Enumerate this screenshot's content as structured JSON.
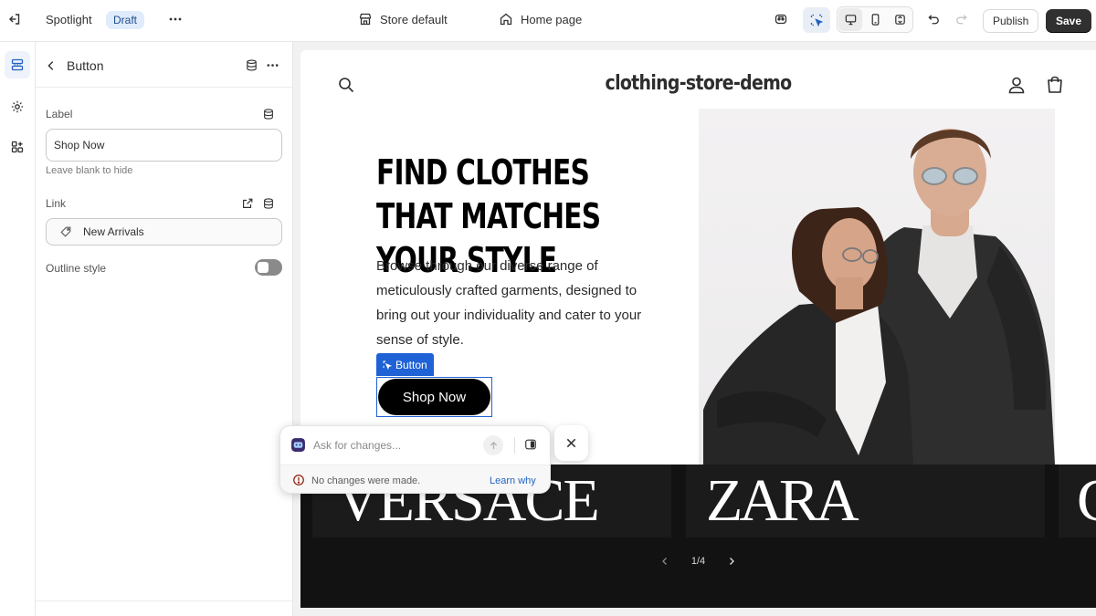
{
  "topbar": {
    "theme_name": "Spotlight",
    "status_badge": "Draft",
    "store_selector": "Store default",
    "page_selector": "Home page",
    "publish_label": "Publish",
    "save_label": "Save"
  },
  "panel": {
    "title": "Button",
    "label_field": {
      "label": "Label",
      "value": "Shop Now",
      "help": "Leave blank to hide"
    },
    "link_field": {
      "label": "Link",
      "value": "New Arrivals"
    },
    "outline_style": {
      "label": "Outline style",
      "enabled": false
    }
  },
  "preview": {
    "store_title": "clothing-store-demo",
    "hero_heading": "FIND CLOTHES THAT MATCHES YOUR STYLE",
    "hero_copy": "Browse through our diverse range of meticulously crafted garments, designed to bring out your individuality and cater to your sense of style.",
    "selection_tag": "Button",
    "cta_label": "Shop Now",
    "brands": [
      "VERSACE",
      "ZARA",
      "C"
    ],
    "pager": "1/4"
  },
  "ask_popover": {
    "placeholder": "Ask for changes...",
    "status": "No changes were made.",
    "learn_link": "Learn why"
  },
  "colors": {
    "accent": "#1f62d6",
    "save_button": "#303030",
    "brand_band": "#121212"
  }
}
